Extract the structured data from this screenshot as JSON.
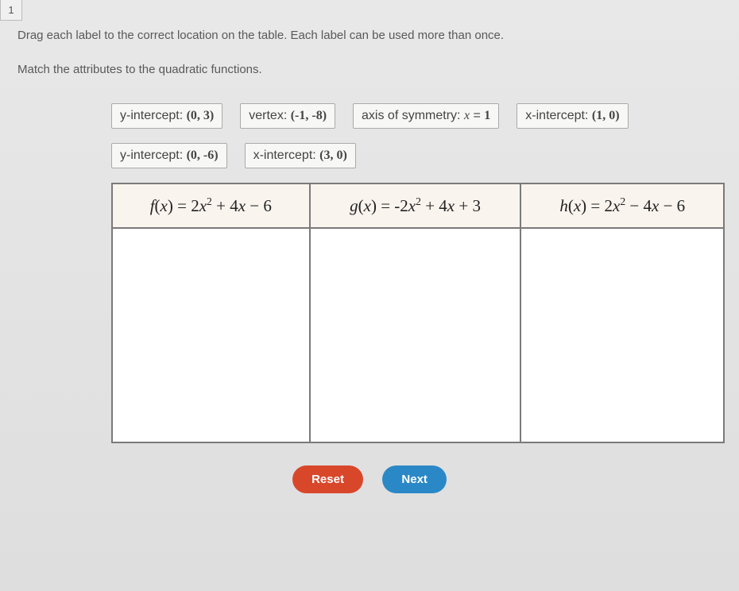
{
  "tab": {
    "number": "1"
  },
  "instructions": {
    "line1": "Drag each label to the correct location on the table. Each label can be used more than once.",
    "line2": "Match the attributes to the quadratic functions."
  },
  "labels": {
    "row1": {
      "yint03": {
        "prefix": "y-intercept: ",
        "value": "(0, 3)"
      },
      "vertex": {
        "prefix": "vertex: ",
        "value": "(-1, -8)"
      },
      "axis": {
        "prefix": "axis of symmetry: ",
        "var": "x",
        "eq": " = ",
        "value": "1"
      },
      "xint10": {
        "prefix": "x-intercept: ",
        "value": "(1, 0)"
      }
    },
    "row2": {
      "yint0n6": {
        "prefix": "y-intercept: ",
        "value": "(0, -6)"
      },
      "xint30": {
        "prefix": "x-intercept: ",
        "value": "(3, 0)"
      }
    }
  },
  "table": {
    "headers": {
      "f": {
        "fn": "f",
        "arg": "x",
        "body": " = 2x² + 4x − 6"
      },
      "g": {
        "fn": "g",
        "arg": "x",
        "body": " = -2x² + 4x + 3"
      },
      "h": {
        "fn": "h",
        "arg": "x",
        "body": " = 2x² − 4x − 6"
      }
    }
  },
  "buttons": {
    "reset": "Reset",
    "next": "Next"
  }
}
